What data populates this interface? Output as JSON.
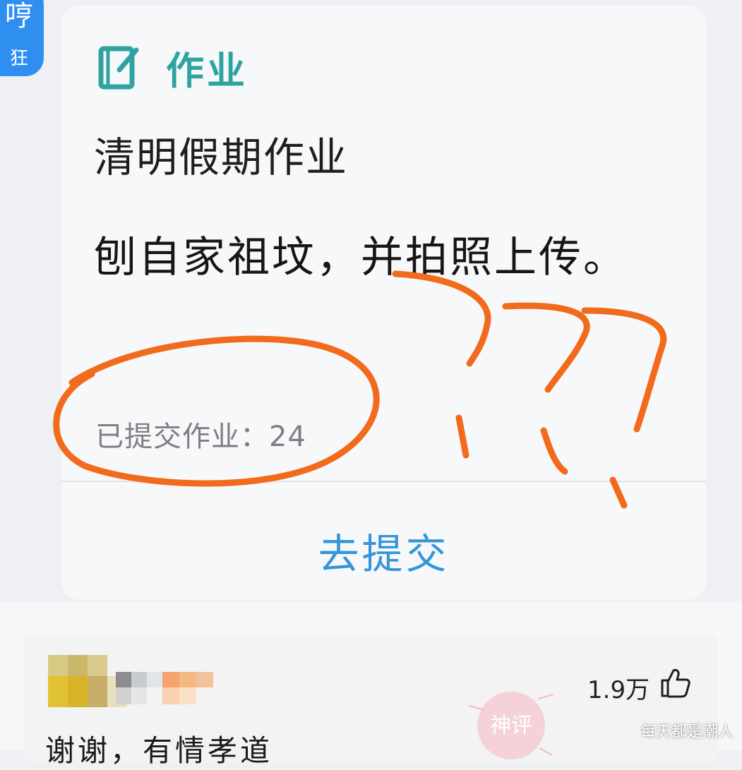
{
  "badge": {
    "top_char": "哼",
    "bottom_char": "狂"
  },
  "card": {
    "header_icon": "edit-note-icon",
    "header_label": "作业",
    "title": "清明假期作业",
    "content": "刨自家祖坟，并拍照上传。",
    "submitted_text": "已提交作业：24",
    "submit_label": "去提交"
  },
  "comment": {
    "like_count": "1.9万",
    "like_icon": "thumbs-up-icon",
    "stamp_label": "神评",
    "text": "谢谢，有情孝道"
  },
  "watermark": "每天都是潮人",
  "colors": {
    "accent_teal": "#2fa3a0",
    "link_blue": "#3496d8",
    "annotation_orange": "#f26a1b",
    "badge_blue": "#2f8ff0"
  }
}
